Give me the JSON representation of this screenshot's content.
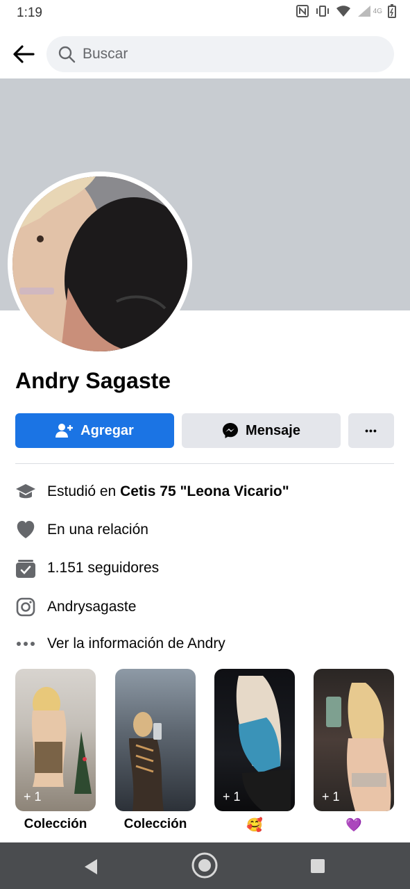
{
  "status": {
    "time": "1:19",
    "network": "4G"
  },
  "search": {
    "placeholder": "Buscar"
  },
  "profile": {
    "name": "Andry Sagaste"
  },
  "actions": {
    "add_label": "Agregar",
    "message_label": "Mensaje",
    "more_label": "•••"
  },
  "info": {
    "education_prefix": "Estudió en ",
    "education_school": "Cetis 75 \"Leona Vicario\"",
    "relationship": "En una relación",
    "followers": "1.151 seguidores",
    "instagram": "Andrysagaste",
    "more_info": "Ver la información de Andry"
  },
  "highlights": [
    {
      "count": "+ 1",
      "caption": "Colección"
    },
    {
      "count": "",
      "caption": "Colección"
    },
    {
      "count": "+ 1",
      "caption": "🥰"
    },
    {
      "count": "+ 1",
      "caption": "💜"
    }
  ],
  "colors": {
    "accent": "#1b74e4",
    "secondary_button": "#e4e6eb",
    "cover": "#c8ccd1",
    "nav_bar": "#4a4c4f"
  }
}
